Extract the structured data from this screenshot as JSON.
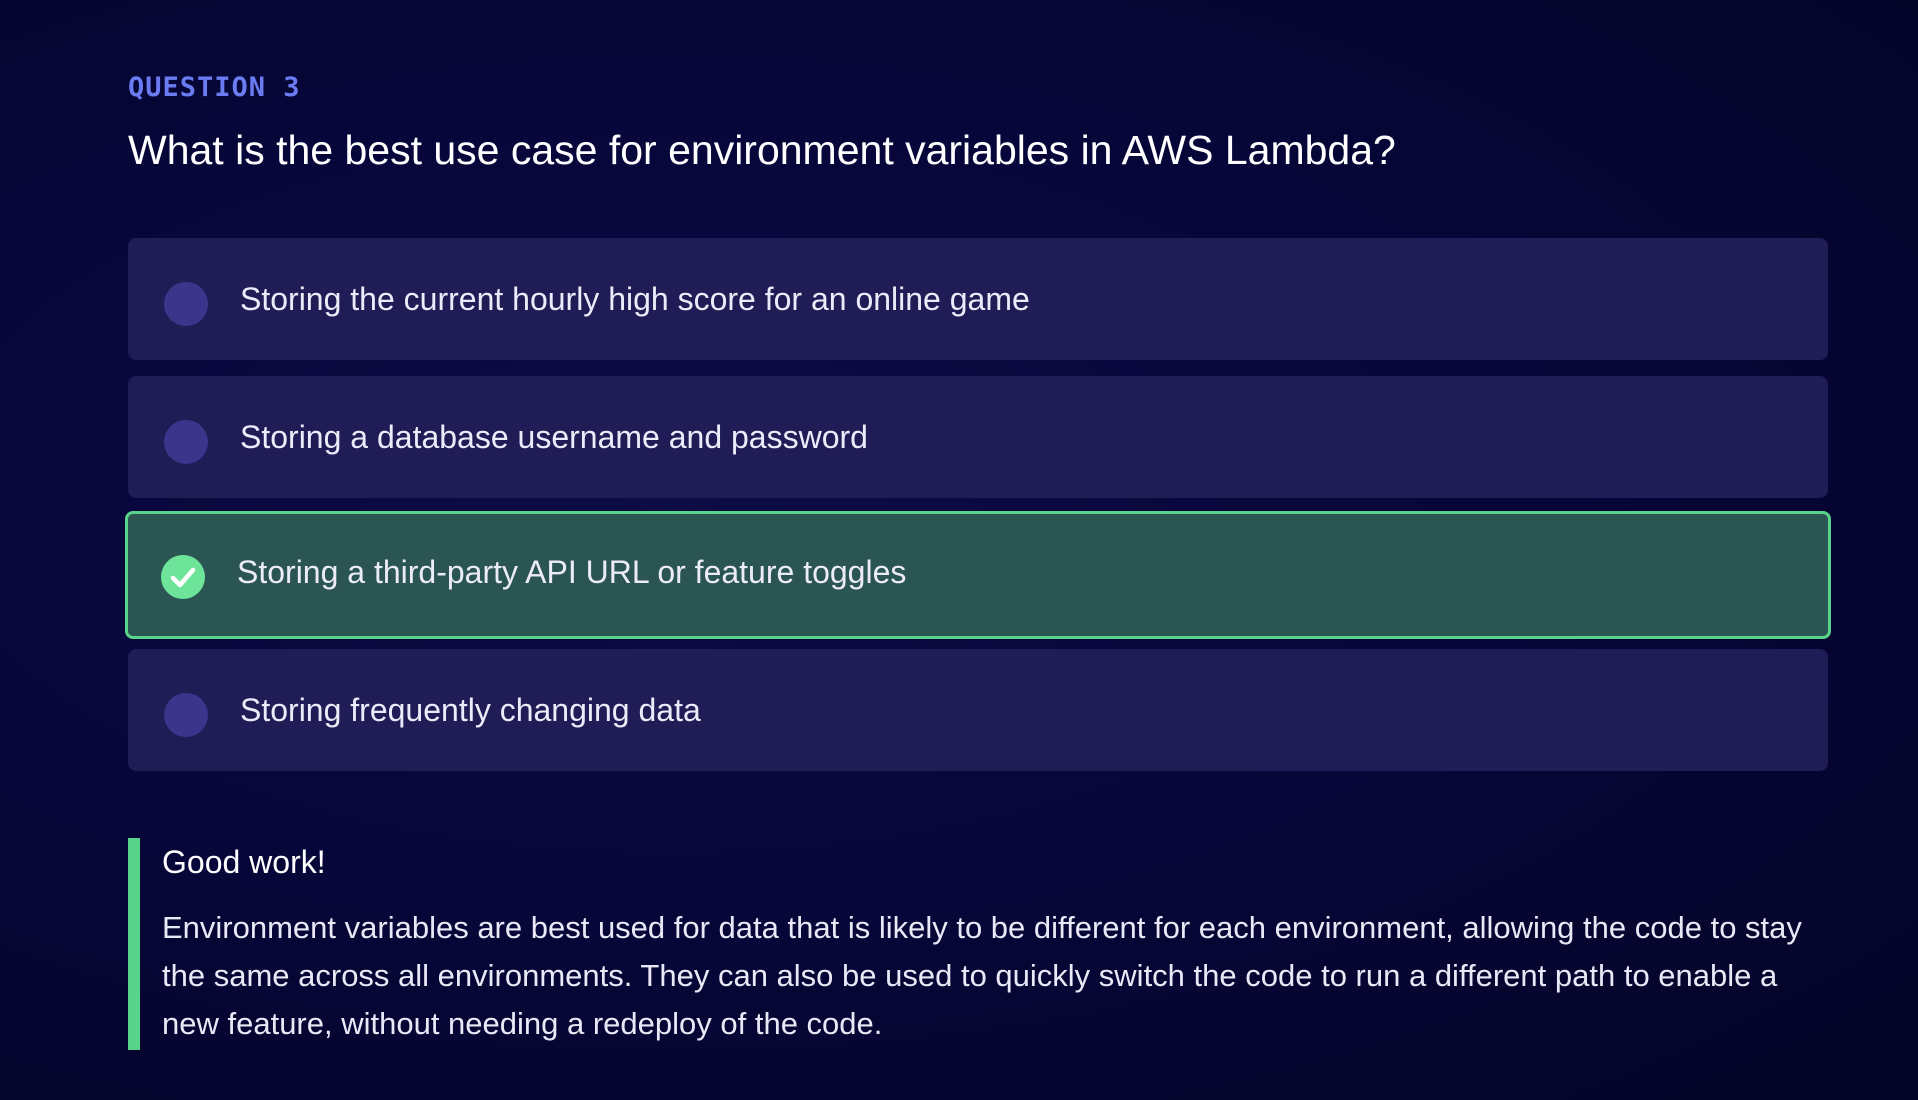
{
  "question": {
    "label": "QUESTION 3",
    "title": "What is the best use case for environment variables in AWS Lambda?"
  },
  "options": [
    {
      "text": "Storing the current hourly high score for an online game",
      "state": "unselected"
    },
    {
      "text": "Storing a database username and password",
      "state": "unselected"
    },
    {
      "text": "Storing a third-party API URL or feature toggles",
      "state": "correct",
      "icon": "check-icon"
    },
    {
      "text": "Storing frequently changing data",
      "state": "unselected"
    }
  ],
  "feedback": {
    "title": "Good work!",
    "body": "Environment variables are best used for data that is likely to be different for each environment, allowing the code to stay the same across all environments. They can also be used to quickly switch the code to run a different path to enable a new feature, without needing a redeploy of the code."
  },
  "colors": {
    "accent_label": "#6b7cf2",
    "option_bg": "#201c55",
    "correct_bg": "#2a5553",
    "correct_border": "#57d38a",
    "radio": "#3b358c"
  }
}
